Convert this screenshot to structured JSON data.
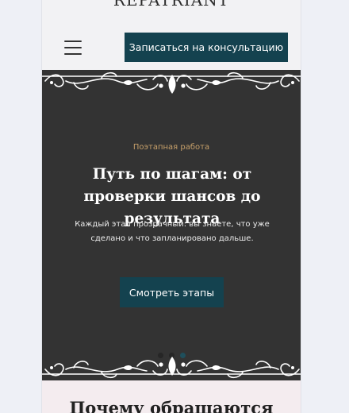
{
  "header": {
    "logo_text": "REPATRIANT",
    "menu_icon": "hamburger-menu-icon",
    "cta_label": "Записаться на консультацию"
  },
  "hero": {
    "eyebrow": "Поэтапная работа",
    "title": "Путь по шагам: от проверки шансов до результата",
    "text": "Каждый этап прозрачный: вы знаете, что уже сделано и что запланировано дальше.",
    "button_label": "Смотреть этапы",
    "slides_total": 3,
    "active_slide": 3,
    "ornament_icon": "flourish-border-icon"
  },
  "next_section": {
    "title": "Почему обращаются"
  },
  "colors": {
    "accent": "#14424f",
    "hero_bg": "#333333",
    "eyebrow": "#c7a06a",
    "page_bg": "#eef0f6"
  }
}
